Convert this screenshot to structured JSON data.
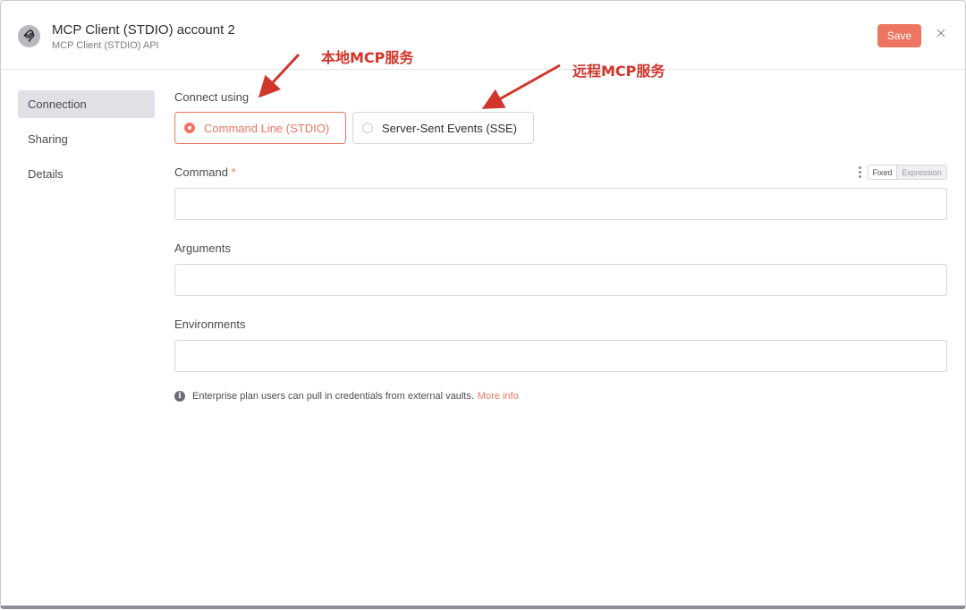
{
  "header": {
    "title": "MCP Client (STDIO) account 2",
    "subtitle": "MCP Client (STDIO) API",
    "save_label": "Save",
    "close_icon": "close-icon",
    "app_icon": "mcp-logo-icon"
  },
  "sidebar": {
    "items": [
      {
        "label": "Connection",
        "active": true
      },
      {
        "label": "Sharing",
        "active": false
      },
      {
        "label": "Details",
        "active": false
      }
    ]
  },
  "connection": {
    "connect_label": "Connect using",
    "options": [
      {
        "label": "Command Line (STDIO)",
        "selected": true
      },
      {
        "label": "Server-Sent Events (SSE)",
        "selected": false
      }
    ],
    "fields": {
      "command": {
        "label": "Command",
        "required_marker": "*",
        "value": ""
      },
      "arguments": {
        "label": "Arguments",
        "value": ""
      },
      "environments": {
        "label": "Environments",
        "value": ""
      }
    },
    "mode_toggle": {
      "fixed": "Fixed",
      "expression": "Expression",
      "selected": "Fixed"
    },
    "info_text": "Enterprise plan users can pull in credentials from external vaults.",
    "info_link": "More info"
  },
  "annotations": {
    "local": "本地MCP服务",
    "remote": "远程MCP服务"
  },
  "colors": {
    "accent": "#ee7660",
    "annotation": "#d2352a",
    "sidebar_active": "#dfe1e7"
  }
}
